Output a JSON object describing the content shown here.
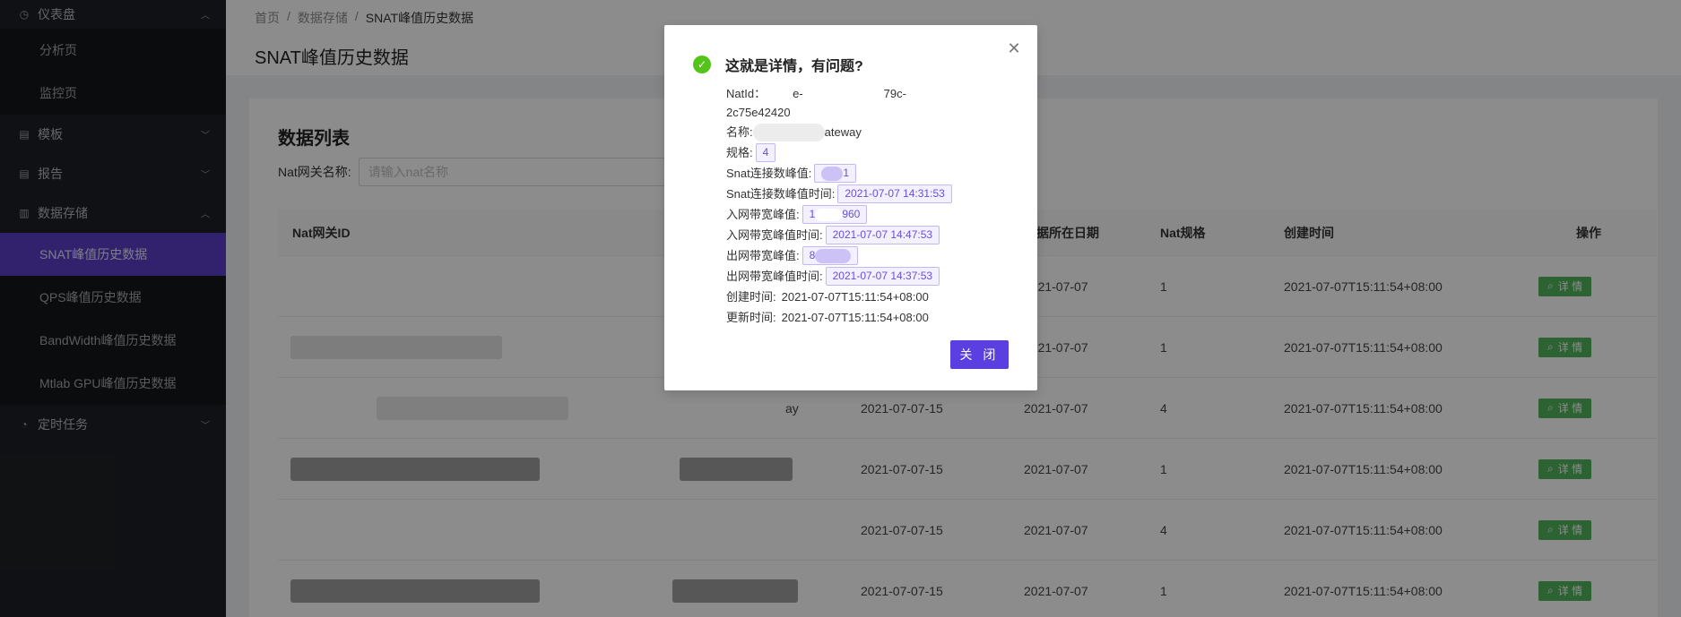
{
  "sidebar": {
    "dashboard": {
      "label": "仪表盘",
      "icon": "dashboard-icon"
    },
    "dashboard_children": [
      "分析页",
      "监控页"
    ],
    "template": {
      "label": "模板",
      "icon": "file-icon"
    },
    "report": {
      "label": "报告",
      "icon": "file-icon"
    },
    "storage": {
      "label": "数据存储",
      "icon": "chart-icon"
    },
    "storage_children": [
      "SNAT峰值历史数据",
      "QPS峰值历史数据",
      "BandWidth峰值历史数据",
      "Mtlab GPU峰值历史数据"
    ],
    "cron": {
      "label": "定时任务",
      "icon": "bell-icon"
    }
  },
  "breadcrumb": [
    "首页",
    "数据存储",
    "SNAT峰值历史数据"
  ],
  "page_title": "SNAT峰值历史数据",
  "card": {
    "title": "数据列表",
    "filter_label": "Nat网关名称:",
    "filter_placeholder": "请输入nat名称"
  },
  "table": {
    "headers": {
      "id": "Nat网关ID",
      "data_date": "数据所在日期",
      "spec": "Nat规格",
      "created": "创建时间",
      "op": "操作"
    },
    "detail_label": "详 情",
    "rows": [
      {
        "name": "",
        "date": "",
        "data_date": "2021-07-07",
        "spec": "1",
        "created": "2021-07-07T15:11:54+08:00"
      },
      {
        "name": "",
        "date": "",
        "data_date": "2021-07-07",
        "spec": "1",
        "created": "2021-07-07T15:11:54+08:00"
      },
      {
        "name": "ay",
        "date": "2021-07-07-15",
        "data_date": "2021-07-07",
        "spec": "4",
        "created": "2021-07-07T15:11:54+08:00"
      },
      {
        "name": "",
        "date": "2021-07-07-15",
        "data_date": "2021-07-07",
        "spec": "1",
        "created": "2021-07-07T15:11:54+08:00"
      },
      {
        "name": "",
        "date": "2021-07-07-15",
        "data_date": "2021-07-07",
        "spec": "4",
        "created": "2021-07-07T15:11:54+08:00"
      },
      {
        "name": "",
        "date": "2021-07-07-15",
        "data_date": "2021-07-07",
        "spec": "1",
        "created": "2021-07-07T15:11:54+08:00"
      }
    ]
  },
  "modal": {
    "title": "这就是详情，有问题?",
    "natid_label": "NatId：",
    "natid_part1": "e-",
    "natid_part2": "79c-",
    "natid_line2": "2c75e42420",
    "name_label": "名称:",
    "name_value": "ateway",
    "spec_label": "规格:",
    "spec_value": "4",
    "snat_peak_label": "Snat连接数峰值:",
    "snat_peak_value": "1",
    "snat_peak_time_label": "Snat连接数峰值时间:",
    "snat_peak_time_value": "2021-07-07 14:31:53",
    "in_peak_label": "入网带宽峰值:",
    "in_peak_value": "1",
    "in_peak_value2": "960",
    "in_peak_time_label": "入网带宽峰值时间:",
    "in_peak_time_value": "2021-07-07 14:47:53",
    "out_peak_label": "出网带宽峰值:",
    "out_peak_value": "8",
    "out_peak_time_label": "出网带宽峰值时间:",
    "out_peak_time_value": "2021-07-07 14:37:53",
    "created_label": "创建时间:",
    "created_value": "2021-07-07T15:11:54+08:00",
    "updated_label": "更新时间:",
    "updated_value": "2021-07-07T15:11:54+08:00",
    "close_label": "关 闭"
  }
}
